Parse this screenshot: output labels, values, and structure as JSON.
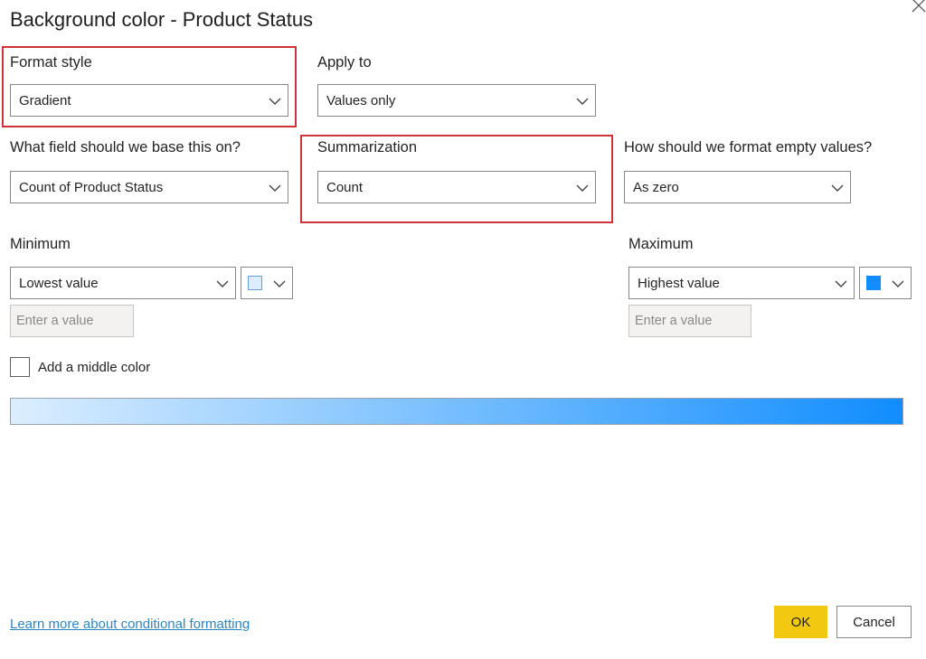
{
  "dialog": {
    "title": "Background color - Product Status",
    "close_icon": "close-icon"
  },
  "format_style": {
    "label": "Format style",
    "value": "Gradient",
    "highlighted": true
  },
  "apply_to": {
    "label": "Apply to",
    "value": "Values only"
  },
  "base_field": {
    "label": "What field should we base this on?",
    "value": "Count of Product Status"
  },
  "summarization": {
    "label": "Summarization",
    "value": "Count",
    "highlighted": true
  },
  "empty_values": {
    "label": "How should we format empty values?",
    "value": "As zero"
  },
  "minimum": {
    "label": "Minimum",
    "value": "Lowest value",
    "color": "#dbeeff",
    "input_placeholder": "Enter a value"
  },
  "maximum": {
    "label": "Maximum",
    "value": "Highest value",
    "color": "#118dff",
    "input_placeholder": "Enter a value"
  },
  "middle_color": {
    "label": "Add a middle color",
    "checked": false
  },
  "gradient": {
    "start_color": "#dbeeff",
    "end_color": "#118dff"
  },
  "footer": {
    "learn_more": "Learn more about conditional formatting",
    "ok_label": "OK",
    "cancel_label": "Cancel"
  },
  "colors": {
    "highlight": "#d13438",
    "ok_button": "#f2c811",
    "link": "#2e86c1"
  }
}
